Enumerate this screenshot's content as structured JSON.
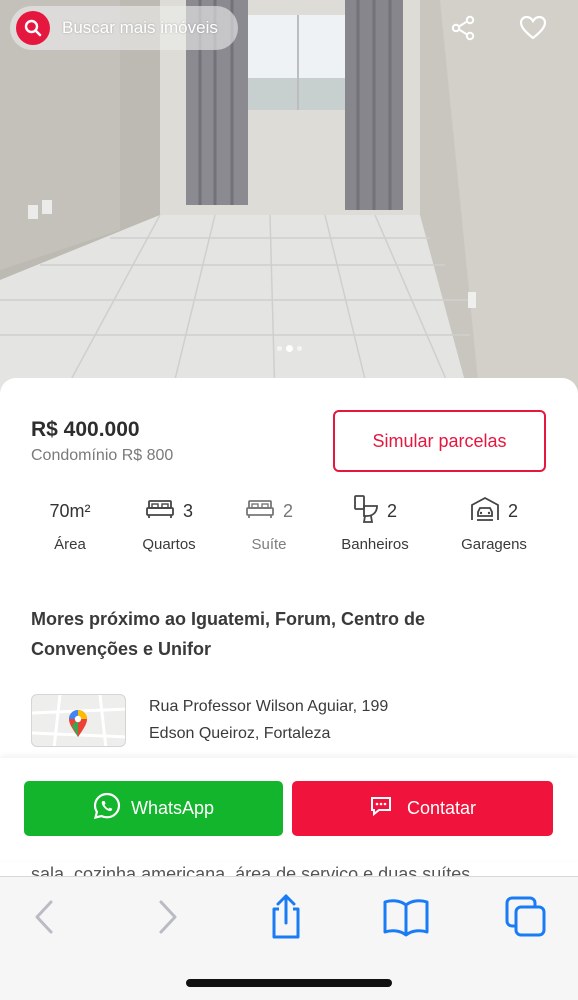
{
  "header": {
    "search_label": "Buscar mais imóveis",
    "icons": [
      "search-icon",
      "share-icon",
      "heart-icon"
    ]
  },
  "carousel": {
    "dots": 3,
    "active": 2
  },
  "listing": {
    "price": "R$ 400.000",
    "condo": "Condomínio R$ 800",
    "simulate_label": "Simular parcelas",
    "features": [
      {
        "value": "70m²",
        "label": "Área",
        "icon": ""
      },
      {
        "value": "3",
        "label": "Quartos",
        "icon": "bed-icon"
      },
      {
        "value": "2",
        "label": "Suíte",
        "icon": "bed-icon"
      },
      {
        "value": "2",
        "label": "Banheiros",
        "icon": "toilet-icon"
      },
      {
        "value": "2",
        "label": "Garagens",
        "icon": "garage-icon"
      }
    ],
    "title": "Mores próximo ao Iguatemi, Forum, Centro de Convenções e Unifor",
    "address_line1": "Rua Professor Wilson Aguiar, 199",
    "address_line2": "Edson Queiroz, Fortaleza",
    "description_peek": "sala, cozinha americana, área de serviço e duas suítes"
  },
  "actions": {
    "whatsapp_label": "WhatsApp",
    "contact_label": "Contatar"
  },
  "colors": {
    "accent": "#e6173f",
    "whatsapp": "#12b52c",
    "contact": "#f0133b",
    "safari_blue": "#1a7cf5"
  },
  "safari": {
    "icons": [
      "back-icon",
      "forward-icon",
      "share-icon",
      "bookmarks-icon",
      "tabs-icon"
    ]
  }
}
